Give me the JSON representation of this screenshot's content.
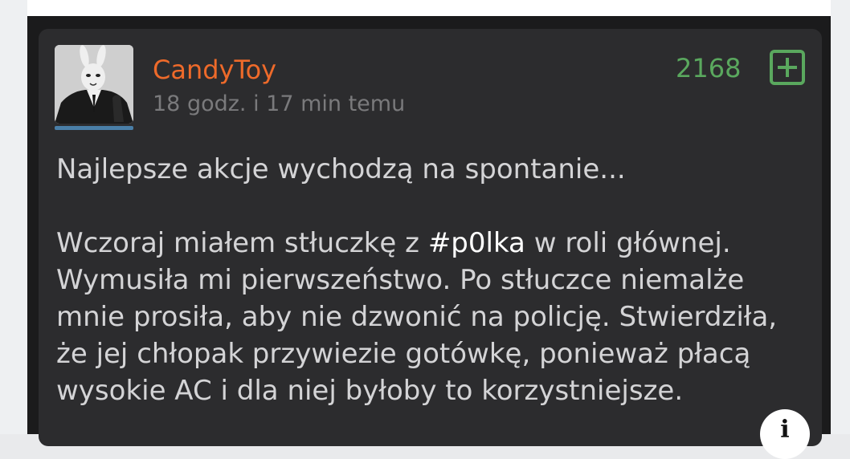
{
  "post": {
    "author": "CandyToy",
    "timestamp": "18 godz. i 17 min temu",
    "votes": "2168",
    "line1": "Najlepsze akcje wychodzą na spontanie...",
    "line2_before": "Wczoraj miałem stłuczkę z ",
    "tag": "#p0lka",
    "line2_after": " w roli głównej.",
    "line3": "Wymusiła mi pierwszeństwo. Po stłuczce niemalże",
    "line4": "mnie prosiła, aby nie dzwonić na policję. Stwierdziła,",
    "line5": "że jej chłopak przywiezie gotówkę, ponieważ płacą",
    "line6": "wysokie AC i dla niej byłoby to korzystniejsze."
  },
  "icons": {
    "avatar": "rabbit-in-suit-avatar",
    "plus": "plus-box-icon",
    "info": "info-icon"
  },
  "colors": {
    "username": "#ee6a2a",
    "votes": "#5aa85e",
    "card_bg": "#2c2c2e",
    "text": "#d4d4d6"
  }
}
